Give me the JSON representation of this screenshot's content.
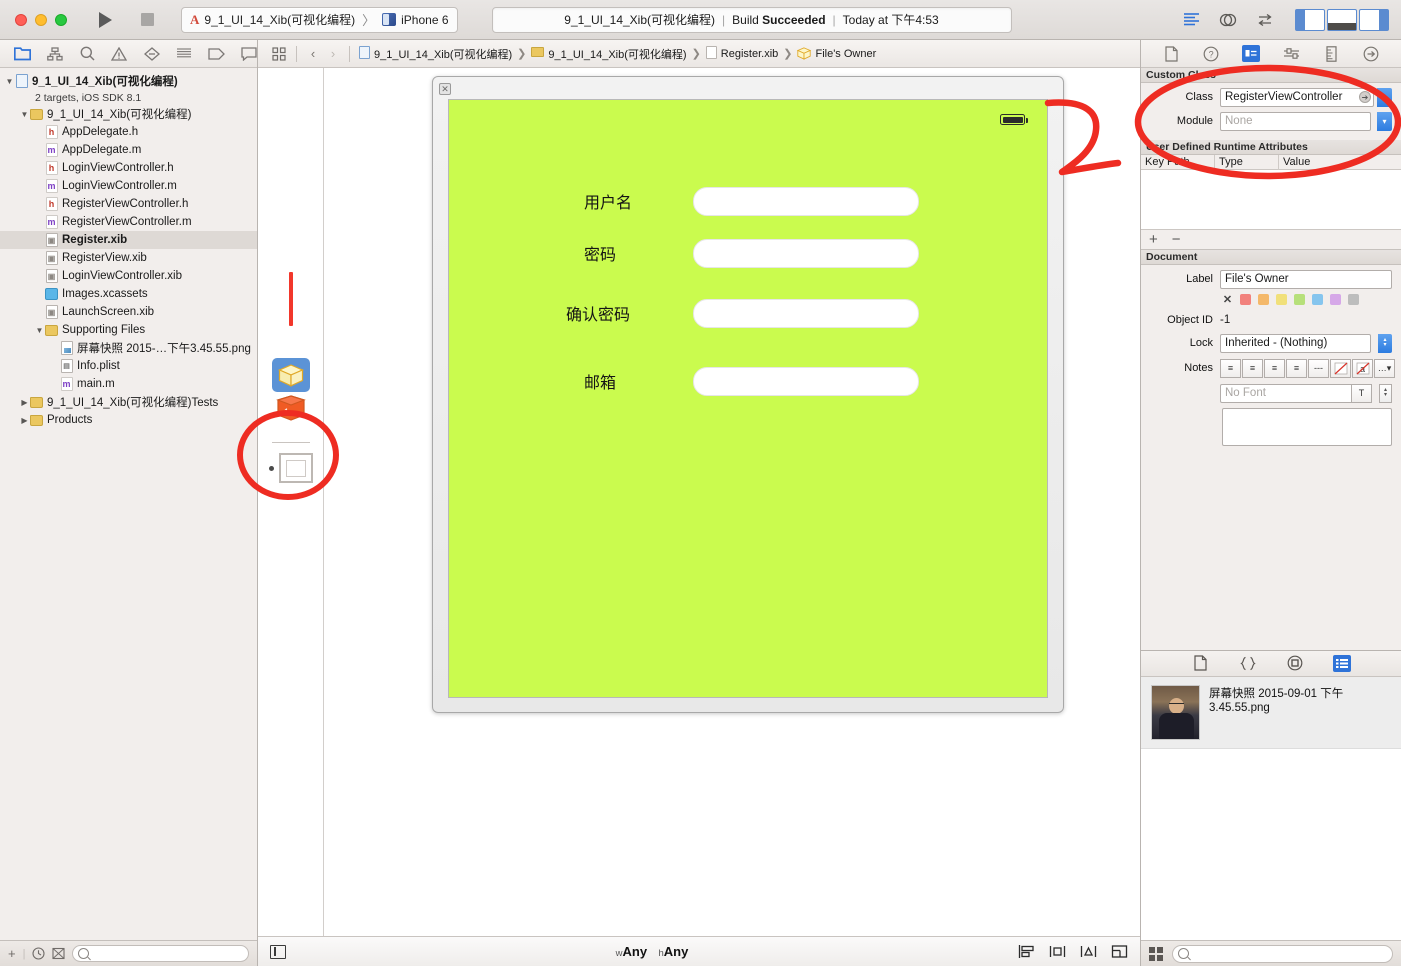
{
  "window": {
    "traffic_lights": [
      "close",
      "minimize",
      "zoom"
    ]
  },
  "toolbar": {
    "run_label": "Run",
    "stop_label": "Stop",
    "scheme_project": "9_1_UI_14_Xib(可视化编程)",
    "scheme_separator": "〉",
    "scheme_device": "iPhone 6",
    "status_project": "9_1_UI_14_Xib(可视化编程)",
    "status_separator": "|",
    "status_build_prefix": "Build ",
    "status_build_result": "Succeeded",
    "status_time_separator": "|",
    "status_time": "Today at 下午4:53",
    "right_icons": [
      "list-view-icon",
      "assistant-editor-icon",
      "version-editor-icon"
    ],
    "panel_toggles": [
      "navigator-toggle",
      "debug-area-toggle",
      "utilities-toggle"
    ]
  },
  "navigator": {
    "tabs": [
      {
        "name": "project-navigator",
        "icon": "folder-icon",
        "active": true
      },
      {
        "name": "symbol-navigator",
        "icon": "hierarchy-icon",
        "active": false
      },
      {
        "name": "find-navigator",
        "icon": "search-icon",
        "active": false
      },
      {
        "name": "issue-navigator",
        "icon": "warning-triangle-icon",
        "active": false
      },
      {
        "name": "test-navigator",
        "icon": "diamond-minus-icon",
        "active": false
      },
      {
        "name": "debug-navigator",
        "icon": "debug-list-icon",
        "active": false
      },
      {
        "name": "breakpoint-navigator",
        "icon": "tag-icon",
        "active": false
      },
      {
        "name": "report-navigator",
        "icon": "speech-bubble-icon",
        "active": false
      }
    ],
    "tree": [
      {
        "label": "9_1_UI_14_Xib(可视化编程)",
        "icon": "project-icon",
        "indent": 0,
        "twisty": "down",
        "bold": true,
        "selected": false
      },
      {
        "label": "2 targets, iOS SDK 8.1",
        "icon": "none",
        "indent": 0,
        "twisty": "none",
        "sub": true,
        "selected": false
      },
      {
        "label": "9_1_UI_14_Xib(可视化编程)",
        "icon": "folder-icon",
        "indent": 1,
        "twisty": "down",
        "bold": false,
        "selected": false
      },
      {
        "label": "AppDelegate.h",
        "icon": "header-file-icon",
        "indent": 2,
        "twisty": "none",
        "selected": false
      },
      {
        "label": "AppDelegate.m",
        "icon": "impl-file-icon",
        "indent": 2,
        "twisty": "none",
        "selected": false
      },
      {
        "label": "LoginViewController.h",
        "icon": "header-file-icon",
        "indent": 2,
        "twisty": "none",
        "selected": false
      },
      {
        "label": "LoginViewController.m",
        "icon": "impl-file-icon",
        "indent": 2,
        "twisty": "none",
        "selected": false
      },
      {
        "label": "RegisterViewController.h",
        "icon": "header-file-icon",
        "indent": 2,
        "twisty": "none",
        "selected": false
      },
      {
        "label": "RegisterViewController.m",
        "icon": "impl-file-icon",
        "indent": 2,
        "twisty": "none",
        "selected": false
      },
      {
        "label": "Register.xib",
        "icon": "xib-file-icon",
        "indent": 2,
        "twisty": "none",
        "bold": true,
        "selected": true
      },
      {
        "label": "RegisterView.xib",
        "icon": "xib-file-icon",
        "indent": 2,
        "twisty": "none",
        "selected": false
      },
      {
        "label": "LoginViewController.xib",
        "icon": "xib-file-icon",
        "indent": 2,
        "twisty": "none",
        "selected": false
      },
      {
        "label": "Images.xcassets",
        "icon": "asset-catalog-icon",
        "indent": 2,
        "twisty": "none",
        "selected": false
      },
      {
        "label": "LaunchScreen.xib",
        "icon": "xib-file-icon",
        "indent": 2,
        "twisty": "none",
        "selected": false
      },
      {
        "label": "Supporting Files",
        "icon": "folder-icon",
        "indent": 2,
        "twisty": "down",
        "selected": false
      },
      {
        "label": "屏幕快照 2015-…下午3.45.55.png",
        "icon": "png-file-icon",
        "indent": 3,
        "twisty": "none",
        "selected": false
      },
      {
        "label": "Info.plist",
        "icon": "plist-file-icon",
        "indent": 3,
        "twisty": "none",
        "selected": false
      },
      {
        "label": "main.m",
        "icon": "impl-file-icon",
        "indent": 3,
        "twisty": "none",
        "selected": false
      },
      {
        "label": "9_1_UI_14_Xib(可视化编程)Tests",
        "icon": "folder-icon",
        "indent": 1,
        "twisty": "right",
        "selected": false
      },
      {
        "label": "Products",
        "icon": "folder-icon",
        "indent": 1,
        "twisty": "right",
        "selected": false
      }
    ],
    "bottom": {
      "add_label": "+",
      "icons": [
        "recent-clock-icon",
        "source-control-icon"
      ],
      "filter_placeholder": ""
    }
  },
  "editor": {
    "jumpbar": {
      "related_items_icon": "related-items-icon",
      "back_arrow": "‹",
      "forward_arrow": "›",
      "breadcrumbs": [
        {
          "label": "9_1_UI_14_Xib(可视化编程)",
          "icon": "project-icon"
        },
        {
          "label": "9_1_UI_14_Xib(可视化编程)",
          "icon": "folder-icon"
        },
        {
          "label": "Register.xib",
          "icon": "xib-file-icon"
        },
        {
          "label": "File's Owner",
          "icon": "files-owner-icon"
        }
      ],
      "chevron": "❯"
    },
    "dock": {
      "items": [
        {
          "name": "files-owner-placeholder",
          "icon": "cube-icon"
        },
        {
          "name": "first-responder-placeholder",
          "icon": "responder-box-icon"
        },
        {
          "name": "view-object",
          "icon": "view-square-icon"
        }
      ]
    },
    "canvas": {
      "device_close_icon": "close-icon",
      "background_color": "#CAFB4E",
      "battery_icon": "battery-icon",
      "form_rows": [
        {
          "label": "用户名",
          "value": "",
          "placeholder": ""
        },
        {
          "label": "密码",
          "value": "",
          "placeholder": ""
        },
        {
          "label": "确认密码",
          "value": "",
          "placeholder": ""
        },
        {
          "label": "邮箱",
          "value": "",
          "placeholder": ""
        }
      ]
    },
    "bottombar": {
      "outline_toggle_icon": "outline-toggle-icon",
      "size_class_w_prefix": "w",
      "size_class_w_value": "Any",
      "size_class_h_prefix": "h",
      "size_class_h_value": "Any",
      "right_icons": [
        "align-icon",
        "pin-icon",
        "resolve-issues-icon",
        "resizing-icon"
      ]
    }
  },
  "inspector": {
    "tabs": [
      {
        "name": "file-inspector",
        "icon": "document-icon",
        "active": false
      },
      {
        "name": "quick-help-inspector",
        "icon": "question-circle-icon",
        "active": false
      },
      {
        "name": "identity-inspector",
        "icon": "identity-card-icon",
        "active": true
      },
      {
        "name": "attributes-inspector",
        "icon": "attributes-slider-icon",
        "active": false
      },
      {
        "name": "size-inspector",
        "icon": "ruler-icon",
        "active": false
      },
      {
        "name": "connections-inspector",
        "icon": "arrow-circle-icon",
        "active": false
      }
    ],
    "custom_class": {
      "title": "Custom Class",
      "class_label": "Class",
      "class_value": "RegisterViewController",
      "module_label": "Module",
      "module_placeholder": "None"
    },
    "runtime_attributes": {
      "title": "User Defined Runtime Attributes",
      "columns": [
        "Key Path",
        "Type",
        "Value"
      ],
      "rows": [],
      "add_label": "+",
      "remove_label": "−"
    },
    "document": {
      "title": "Document",
      "label_label": "Label",
      "label_value": "File's Owner",
      "swatch_clear": "✕",
      "swatches": [
        "#f2817c",
        "#f4b86a",
        "#f1e07a",
        "#b7e07a",
        "#86c5ee",
        "#d6a8e8",
        "#bdbdbd"
      ],
      "object_id_label": "Object ID",
      "object_id_value": "-1",
      "lock_label": "Lock",
      "lock_value": "Inherited - (Nothing)",
      "notes_label": "Notes",
      "notes_buttons": [
        "align-left-icon",
        "align-center-icon",
        "align-right-icon",
        "align-justify-icon",
        "list-dash-icon",
        "no-color-icon",
        "no-text-color-icon",
        "more-icon"
      ],
      "font_placeholder": "No Font",
      "font_button_icon": "font-panel-icon",
      "notes_text": ""
    },
    "library": {
      "tabs": [
        {
          "name": "file-template-library",
          "icon": "document-icon",
          "active": false
        },
        {
          "name": "code-snippet-library",
          "icon": "braces-icon",
          "active": false
        },
        {
          "name": "object-library",
          "icon": "circle-dot-icon",
          "active": false
        },
        {
          "name": "media-library",
          "icon": "media-icon",
          "active": true
        }
      ],
      "items": [
        {
          "name": "屏幕快照 2015-09-01 下午 3.45.55.png",
          "thumbnail": "photo-thumbnail"
        }
      ]
    },
    "bottom": {
      "grid_icon": "grid-icon",
      "filter_placeholder": ""
    }
  },
  "annotations": {
    "circles": [
      {
        "name": "custom-class-highlight-circle",
        "color": "#ee2c22"
      },
      {
        "name": "dock-objects-highlight-circle",
        "color": "#ee2c22"
      }
    ],
    "arrow": {
      "name": "pointer-arrow",
      "color": "#ee2c22"
    },
    "bar": {
      "name": "dock-highlight-bar",
      "color": "#f2372b"
    }
  }
}
